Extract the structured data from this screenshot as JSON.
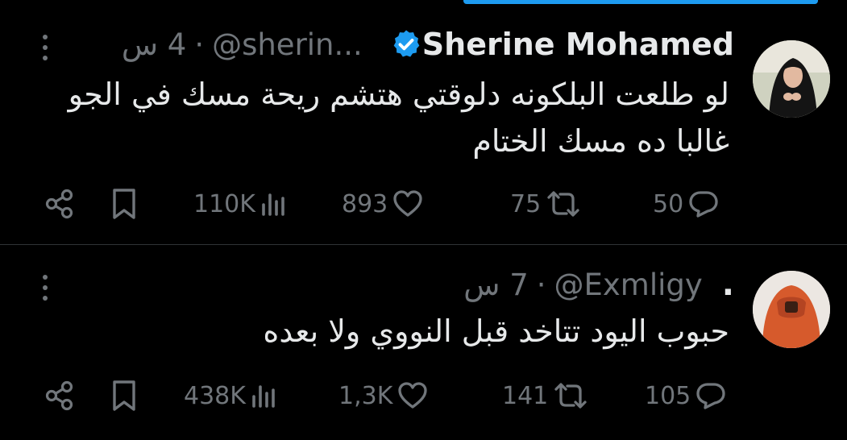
{
  "tweets": [
    {
      "author_name": "Sherine Mohamed",
      "verified": true,
      "handle": "@sherin...",
      "separator": "·",
      "time": "4 س",
      "text_lines": [
        "لو طلعت البلكونه دلوقتي هتشم ريحة مسك في الجو",
        "غالبا ده مسك الختام"
      ],
      "stats": {
        "replies": "50",
        "reposts": "75",
        "likes": "893",
        "views": "110K"
      }
    },
    {
      "lead_dot": ".",
      "handle": "@Exmligy",
      "separator": "·",
      "time": "7 س",
      "text_lines": [
        "حبوب اليود تتاخد قبل النووي ولا بعده"
      ],
      "stats": {
        "replies": "105",
        "reposts": "141",
        "likes": "1,3K",
        "views": "438K"
      }
    }
  ],
  "colors": {
    "background": "#000000",
    "text": "#e7e9ea",
    "muted": "#71767b",
    "accent": "#1d9bf0",
    "divider": "#2f3336"
  }
}
